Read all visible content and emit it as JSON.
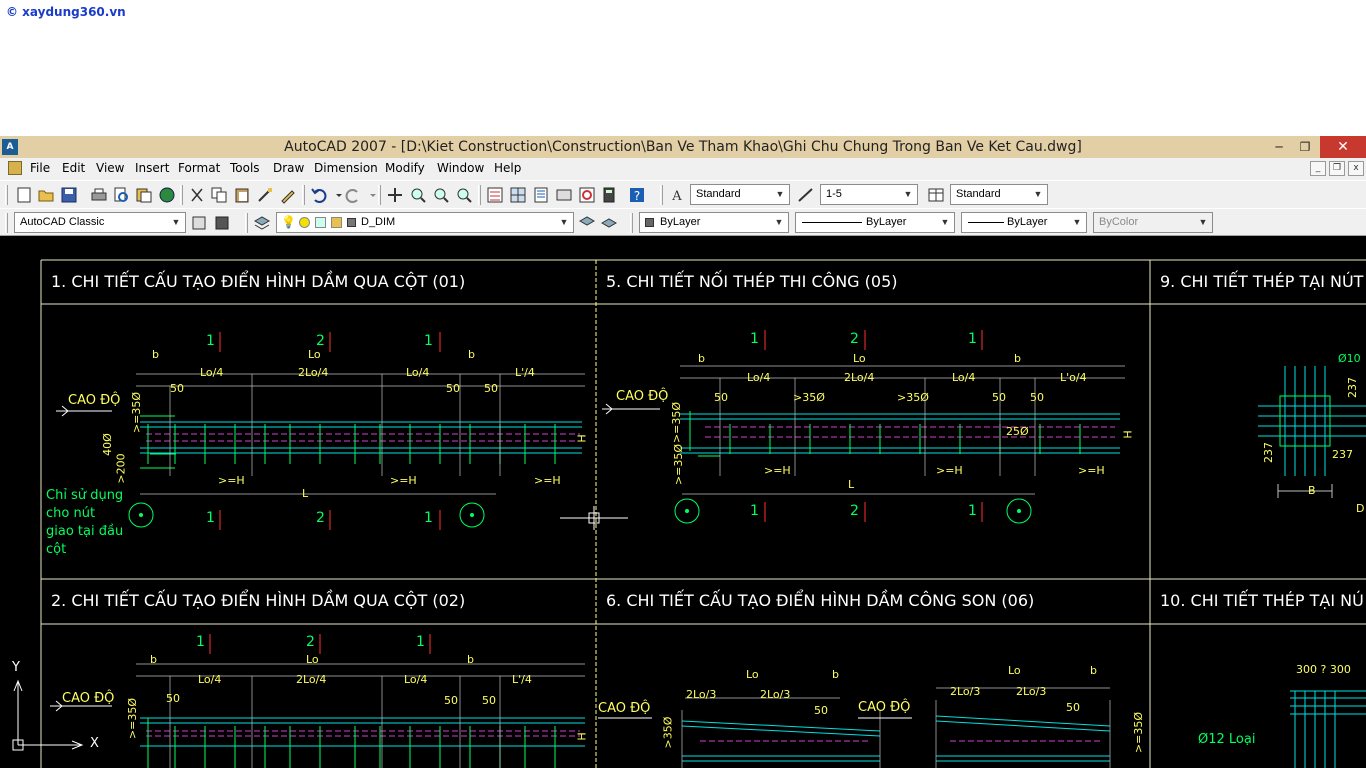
{
  "watermark": "© xaydung360.vn",
  "window": {
    "title": "AutoCAD 2007 - [D:\\Kiet Construction\\Construction\\Ban Ve Tham Khao\\Ghi Chu Chung Trong Ban Ve Ket Cau.dwg]"
  },
  "menu": [
    "File",
    "Edit",
    "View",
    "Insert",
    "Format",
    "Tools",
    "Draw",
    "Dimension",
    "Modify",
    "Window",
    "Help"
  ],
  "toolbar": {
    "text_style": "Standard",
    "dim_style": "1-5",
    "table_style": "Standard",
    "workspace": "AutoCAD Classic",
    "layer": "D_DIM",
    "color": "ByLayer",
    "linetype": "ByLayer",
    "lineweight": "ByLayer",
    "plotstyle": "ByColor"
  },
  "frames": [
    {
      "title": "1. CHI TIẾT CẤU TẠO ĐIỂN HÌNH DẦM QUA CỘT (01)"
    },
    {
      "title": "5. CHI TIẾT NỐI THÉP THI CÔNG (05)"
    },
    {
      "title": "9. CHI TIẾT THÉP TẠI NÚT"
    },
    {
      "title": "2. CHI TIẾT CẤU TẠO ĐIỂN HÌNH DẦM QUA CỘT (02)"
    },
    {
      "title": "6. CHI TIẾT CẤU TẠO ĐIỂN HÌNH DẦM CÔNG SON (06)"
    },
    {
      "title": "10. CHI TIẾT THÉP TẠI NÚ"
    }
  ],
  "labels": {
    "cao_do": "CAO ĐỘ",
    "note": [
      "Chỉ sử dụng",
      "cho nút",
      "giao tại đầu",
      "cột"
    ],
    "b": "b",
    "lo": "Lo",
    "lo4": "Lo/4",
    "lo24": "2Lo/4",
    "l4": "L'/4",
    "l4b": "L'o/4",
    "fifty": "50",
    "gh": ">=H",
    "l": "L",
    "h": "H",
    "g35": ">=35Ø",
    "g40": "40Ø",
    "g200": ">200",
    "g35b": ">35Ø",
    "g25": "25Ø",
    "one": "1",
    "two": "2",
    "lo3": "2Lo/3",
    "phi10": "Ø10",
    "n237": "237",
    "bb": "B",
    "dd": "D",
    "n300": "300 ? 300",
    "phi12": "Ø12 Loại",
    "y": "Y",
    "x": "X"
  }
}
